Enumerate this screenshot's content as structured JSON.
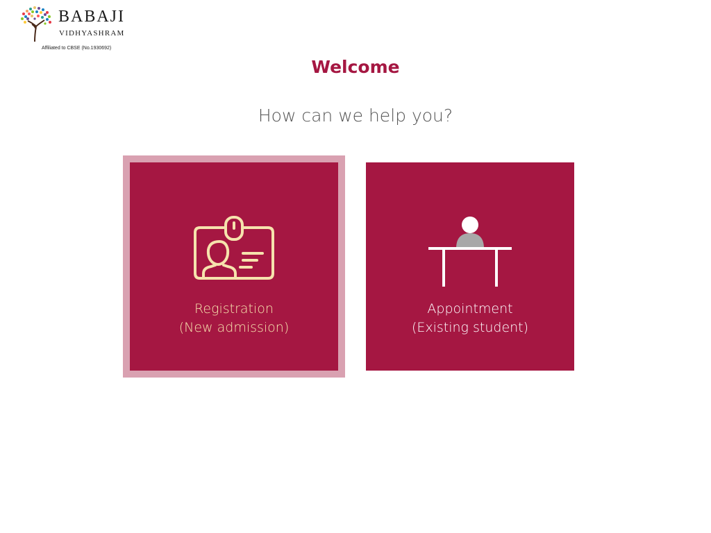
{
  "logo": {
    "name": "BABAJI",
    "subtitle": "VIDHYASHRAM",
    "affiliation": "Affiliated to CBSE (No.1930692)"
  },
  "welcome": "Welcome",
  "prompt": "How can we help you?",
  "options": [
    {
      "line1": "Registration",
      "line2": "(New admission)",
      "icon": "id-card-icon",
      "selected": true
    },
    {
      "line1": "Appointment",
      "line2": "(Existing student)",
      "icon": "person-at-desk-icon",
      "selected": false
    }
  ],
  "colors": {
    "brand": "#a51742",
    "highlight": "#d9a1b1",
    "registration_text": "#f6e3ad",
    "appointment_text": "#ffffff"
  }
}
